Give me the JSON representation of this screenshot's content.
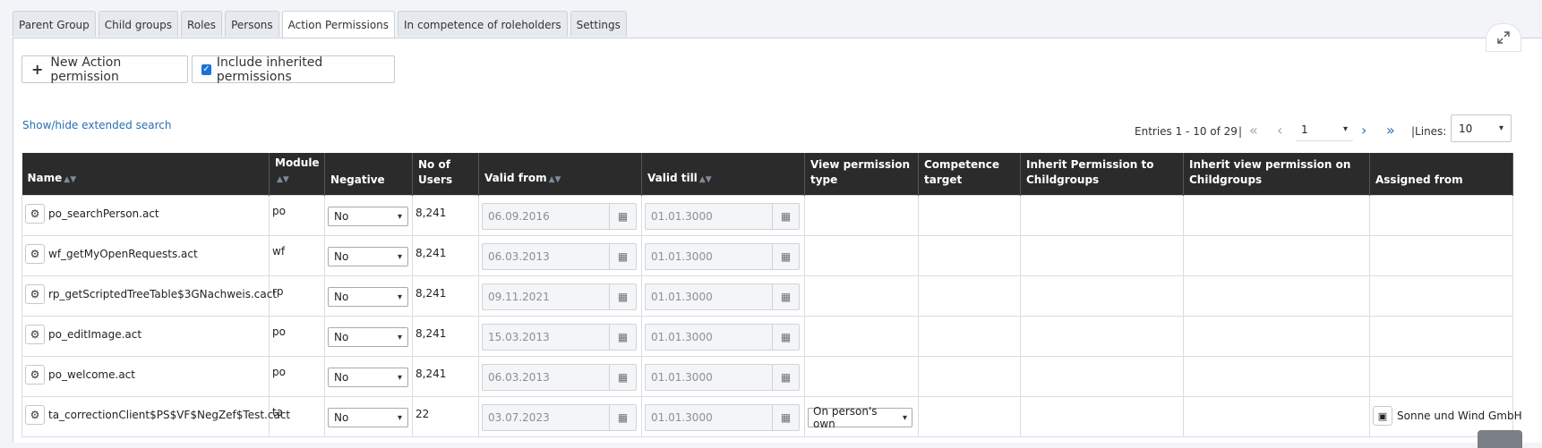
{
  "tabs": [
    {
      "label": "Parent Group",
      "active": false
    },
    {
      "label": "Child groups",
      "active": false
    },
    {
      "label": "Roles",
      "active": false
    },
    {
      "label": "Persons",
      "active": false
    },
    {
      "label": "Action Permissions",
      "active": true
    },
    {
      "label": "In competence of roleholders",
      "active": false
    },
    {
      "label": "Settings",
      "active": false
    }
  ],
  "toolbar": {
    "new_label": "New Action permission",
    "inherit_label": "Include inherited permissions",
    "inherit_checked": true
  },
  "extended_search": "Show/hide extended search",
  "pagination": {
    "entries": "Entries 1 - 10 of 29",
    "separator": "|",
    "page": "1",
    "lines_label": "|Lines:",
    "lines_value": "10"
  },
  "table": {
    "headers": {
      "name": "Name",
      "module": "Module",
      "negative": "Negative",
      "users_line1": "No of",
      "users_line2": "Users",
      "valid_from": "Valid from",
      "valid_till": "Valid till",
      "view_type_line1": "View permission",
      "view_type_line2": "type",
      "competence_line1": "Competence",
      "competence_line2": "target",
      "inherit_line1": "Inherit Permission to",
      "inherit_line2": "Childgroups",
      "inherit_view_line1": "Inherit view permission on",
      "inherit_view_line2": "Childgroups",
      "assigned": "Assigned from"
    },
    "rows": [
      {
        "name": "po_searchPerson.act",
        "module": "po",
        "negative": "No",
        "users": "8,241",
        "valid_from": "06.09.2016",
        "valid_till": "01.01.3000",
        "view_type": "",
        "assigned": ""
      },
      {
        "name": "wf_getMyOpenRequests.act",
        "module": "wf",
        "negative": "No",
        "users": "8,241",
        "valid_from": "06.03.2013",
        "valid_till": "01.01.3000",
        "view_type": "",
        "assigned": ""
      },
      {
        "name": "rp_getScriptedTreeTable$3GNachweis.cact",
        "module": "rp",
        "negative": "No",
        "users": "8,241",
        "valid_from": "09.11.2021",
        "valid_till": "01.01.3000",
        "view_type": "",
        "assigned": ""
      },
      {
        "name": "po_editImage.act",
        "module": "po",
        "negative": "No",
        "users": "8,241",
        "valid_from": "15.03.2013",
        "valid_till": "01.01.3000",
        "view_type": "",
        "assigned": ""
      },
      {
        "name": "po_welcome.act",
        "module": "po",
        "negative": "No",
        "users": "8,241",
        "valid_from": "06.03.2013",
        "valid_till": "01.01.3000",
        "view_type": "",
        "assigned": ""
      },
      {
        "name": "ta_correctionClient$PS$VF$NegZef$Test.cact",
        "module": "ta",
        "negative": "No",
        "users": "22",
        "valid_from": "03.07.2023",
        "valid_till": "01.01.3000",
        "view_type": "On person's own",
        "assigned": "Sonne und Wind GmbH"
      }
    ]
  }
}
